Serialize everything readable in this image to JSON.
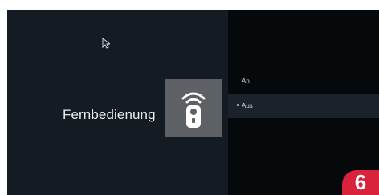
{
  "screen": {
    "title": "Fernbedienung",
    "icon": "remote-icon",
    "cursor_icon": "mouse-pointer-icon"
  },
  "options": [
    {
      "label": "An",
      "selected": false
    },
    {
      "label": "Aus",
      "selected": true
    }
  ],
  "badge": {
    "page_number": "6"
  },
  "colors": {
    "left_background": "#141b22",
    "right_background": "#06090c",
    "selected_row": "#1b2229",
    "icon_tile": "#5d6064",
    "badge_red": "#d9223c",
    "text": "#e9ecef"
  }
}
